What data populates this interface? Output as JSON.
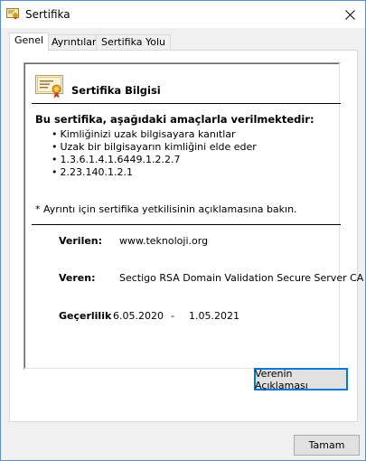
{
  "window": {
    "title": "Sertifika"
  },
  "tabs": [
    {
      "label": "Genel",
      "active": true
    },
    {
      "label": "Ayrıntılar",
      "active": false
    },
    {
      "label": "Sertifika Yolu",
      "active": false
    }
  ],
  "certificate": {
    "heading": "Sertifika Bilgisi",
    "purpose_heading": "Bu sertifika, aşağıdaki amaçlarla verilmektedir:",
    "purposes": [
      "Kimliğinizi uzak bilgisayara kanıtlar",
      "Uzak bir bilgisayarın kimliğini elde eder",
      "1.3.6.1.4.1.6449.1.2.2.7",
      "2.23.140.1.2.1"
    ],
    "note": "* Ayrıntı için sertifika yetkilisinin açıklamasına bakın.",
    "issued_to_label": "Verilen:",
    "issued_to_value": "www.teknoloji.org",
    "issued_by_label": "Veren:",
    "issued_by_value": "Sectigo RSA Domain Validation Secure Server CA",
    "validity_label": "Geçerlilik",
    "valid_from": "6.05.2020",
    "validity_separator": "-",
    "valid_to": "1.05.2021"
  },
  "buttons": {
    "issuer_statement": "Verenin Açıklaması",
    "ok": "Tamam"
  },
  "icons": {
    "title": "certificate-icon",
    "close": "close-icon",
    "certificate": "certificate-icon"
  }
}
